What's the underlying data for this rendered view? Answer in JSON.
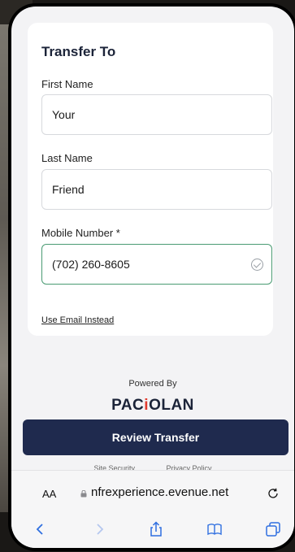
{
  "card": {
    "title": "Transfer To",
    "first_name_label": "First Name",
    "first_name_value": "Your",
    "last_name_label": "Last Name",
    "last_name_value": "Friend",
    "mobile_label": "Mobile Number *",
    "mobile_value": "(702) 260-8605",
    "email_link": "Use Email Instead"
  },
  "footer": {
    "powered_by": "Powered By",
    "brand_left": "PAC",
    "brand_accent": "i",
    "brand_right": "OLAN",
    "review_button": "Review Transfer",
    "link_1": "Site Security",
    "link_2": "Privacy Policy"
  },
  "browser": {
    "text_size": "AA",
    "url": "nfrexperience.evenue.net"
  },
  "colors": {
    "primary": "#1f2a4e",
    "accent": "#e23a2e",
    "valid": "#4a9b73"
  },
  "icons": [
    "check-circle-icon",
    "lock-icon",
    "reload-icon",
    "back-icon",
    "forward-icon",
    "share-icon",
    "bookmarks-icon",
    "tabs-icon"
  ]
}
